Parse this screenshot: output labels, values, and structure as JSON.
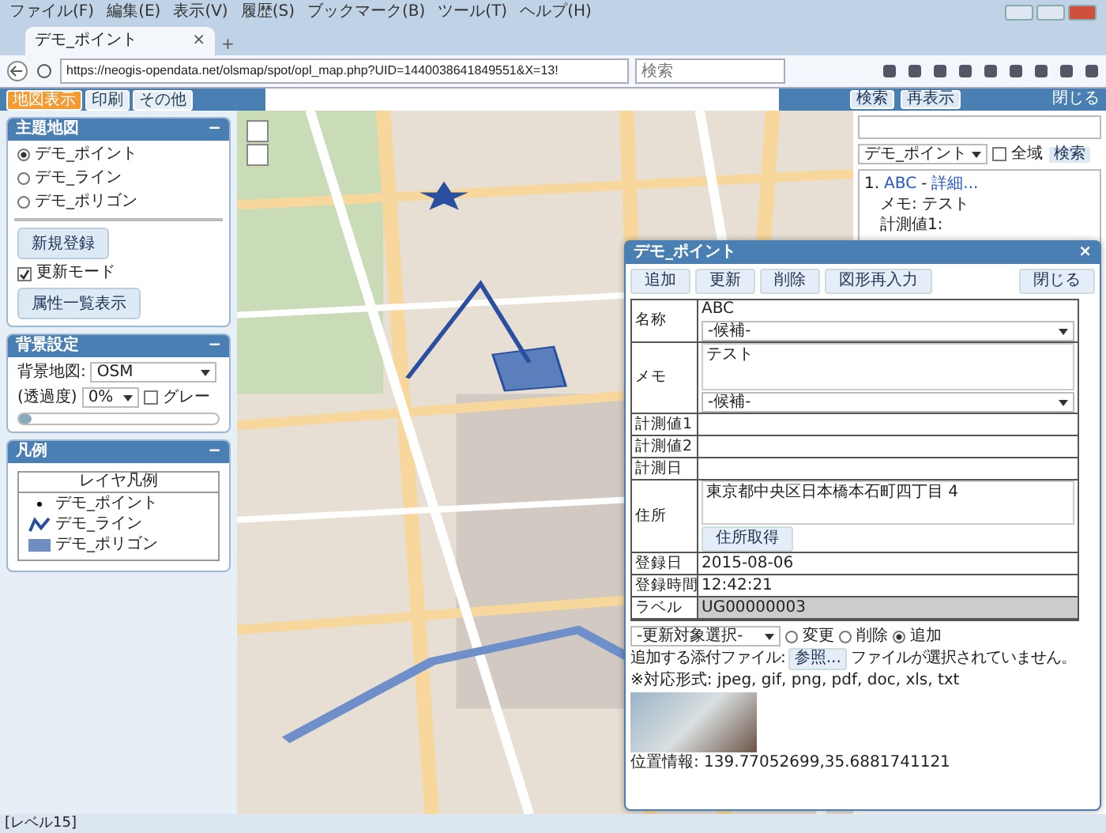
{
  "browser": {
    "menu": [
      "ファイル(F)",
      "編集(E)",
      "表示(V)",
      "履歴(S)",
      "ブックマーク(B)",
      "ツール(T)",
      "ヘルプ(H)"
    ],
    "tab": {
      "title": "デモ_ポイント",
      "close": "×",
      "new_tab": "+"
    },
    "url": "https://neogis-opendata.net/olsmap/spot/opl_map.php?UID=1440038641849551&X=13!",
    "search": {
      "placeholder": "検索"
    }
  },
  "app_tabs": [
    {
      "label": "地図表示",
      "selected": true
    },
    {
      "label": "印刷",
      "selected": false
    },
    {
      "label": "その他",
      "selected": false
    }
  ],
  "left_panels": {
    "theme": {
      "title": "主題地図",
      "collapse": "−",
      "layers": [
        {
          "label": "デモ_ポイント",
          "selected": true
        },
        {
          "label": "デモ_ライン",
          "selected": false
        },
        {
          "label": "デモ_ポリゴン",
          "selected": false
        }
      ],
      "new_button": "新規登録",
      "update_mode": {
        "label": "更新モード",
        "checked": true
      },
      "list_button": "属性一覧表示"
    },
    "background": {
      "title": "背景設定",
      "collapse": "−",
      "map_label": "背景地図:",
      "map_value": "OSM",
      "opacity_label": "(透過度)",
      "opacity_value": "0%",
      "gray": {
        "label": "グレー",
        "checked": false
      },
      "slider": {
        "level": 0
      }
    },
    "legend": {
      "title": "凡例",
      "collapse": "−",
      "box_title": "レイヤ凡例",
      "items": [
        {
          "kind": "point",
          "label": "デモ_ポイント"
        },
        {
          "kind": "line",
          "label": "デモ_ライン"
        },
        {
          "kind": "polygon",
          "label": "デモ_ポリゴン"
        }
      ]
    }
  },
  "search_panel": {
    "buttons": [
      "検索",
      "再表示"
    ],
    "close": "閉じる",
    "layer": "デモ_ポイント",
    "all_area": {
      "label": "全域",
      "checked": false
    },
    "search_button": "検索",
    "results": [
      {
        "number": "1.",
        "name": "ABC",
        "separator": "-",
        "detail": "詳細...",
        "lines": [
          "メモ: テスト",
          "計測値1:"
        ]
      }
    ]
  },
  "dialog": {
    "title": "デモ_ポイント",
    "close": "×",
    "buttons": [
      "追加",
      "更新",
      "削除",
      "図形再入力"
    ],
    "close_button": "閉じる",
    "fields": [
      {
        "kind": "text_select",
        "label": "名称",
        "value": "ABC",
        "select": "-候補-"
      },
      {
        "kind": "area_select",
        "label": "メモ",
        "value": "テスト",
        "select": "-候補-"
      },
      {
        "kind": "text",
        "label": "計測値1"
      },
      {
        "kind": "text",
        "label": "計測値2"
      },
      {
        "kind": "text",
        "label": "計測日"
      },
      {
        "kind": "area_button",
        "label": "住所",
        "value": "東京都中央区日本橋本石町四丁目 4",
        "button": "住所取得"
      },
      {
        "kind": "text",
        "label": "登録日",
        "value": "2015-08-06"
      },
      {
        "kind": "text",
        "label": "登録時間",
        "value": "12:42:21"
      },
      {
        "kind": "readonly",
        "label": "ラベル",
        "value": "UG00000003"
      }
    ],
    "target_select": "-更新対象選択-",
    "actions": [
      {
        "label": "変更",
        "selected": false
      },
      {
        "label": "削除",
        "selected": false
      },
      {
        "label": "追加",
        "selected": true
      }
    ],
    "file_label": "追加する添付ファイル:",
    "browse": "参照...",
    "no_file": "ファイルが選択されていません。",
    "formats": "※対応形式: jpeg, gif, png, pdf, doc, xls, txt",
    "position": "位置情報: 139.77052699,35.6881741121"
  },
  "status_bar": "[レベル15]"
}
